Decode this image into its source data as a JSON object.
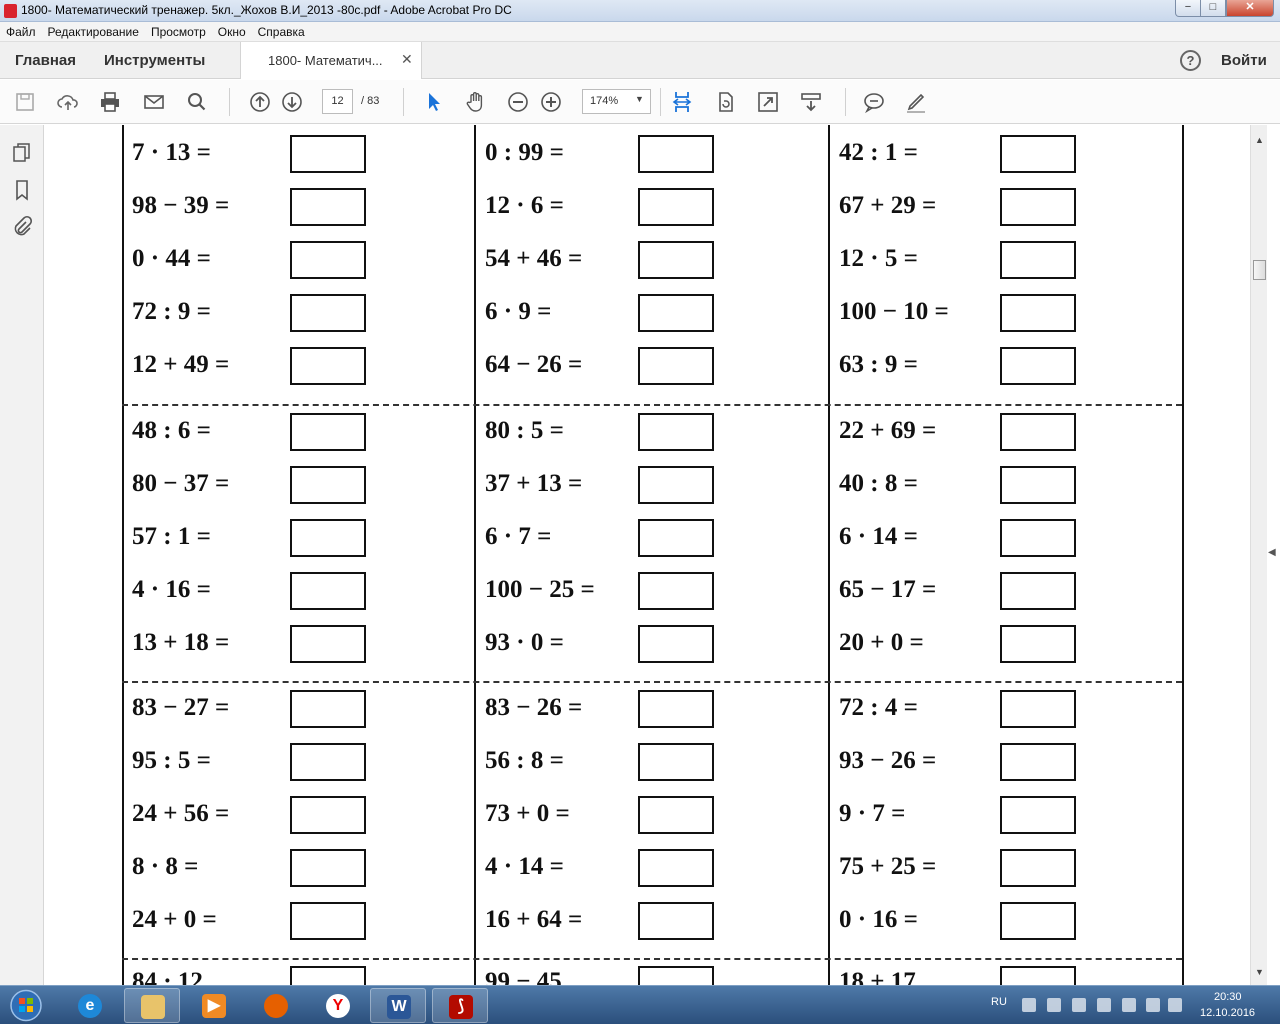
{
  "window": {
    "title": "1800- Математический тренажер. 5кл._Жохов В.И_2013 -80с.pdf - Adobe Acrobat Pro DC",
    "controls": {
      "minimize": "−",
      "maximize": "□",
      "close": "✕"
    }
  },
  "menu": [
    "Файл",
    "Редактирование",
    "Просмотр",
    "Окно",
    "Справка"
  ],
  "nav": {
    "home": "Главная",
    "tools": "Инструменты",
    "doc_tab": "1800- Математич...",
    "doc_tab_close": "✕",
    "help": "?",
    "sign_in": "Войти"
  },
  "toolbar": {
    "page_current": "12",
    "page_total": "/ 83",
    "zoom": "174%",
    "zoom_dropdown": "▼",
    "icons": [
      "save-icon",
      "upload-icon",
      "print-icon",
      "email-icon",
      "search-icon",
      "page-up-icon",
      "page-down-icon",
      "select-cursor-icon",
      "hand-tool-icon",
      "zoom-out-icon",
      "zoom-in-icon",
      "fit-page-icon",
      "rotate-icon",
      "fullscreen-icon",
      "scroll-mode-icon",
      "comment-icon",
      "pen-icon"
    ]
  },
  "left_rail": {
    "icons": [
      "pages-icon",
      "bookmark-icon",
      "attachment-icon"
    ],
    "collapse": "◀"
  },
  "scrollbar": {
    "up": "▲",
    "down": "▼",
    "expand": "◀"
  },
  "worksheet": {
    "blocks": [
      [
        [
          "7 · 13 =",
          "98 − 39 =",
          "0 · 44 =",
          "72 : 9 =",
          "12 + 49 ="
        ],
        [
          "0 : 99 =",
          "12 · 6 =",
          "54 + 46 =",
          "6 · 9 =",
          "64 − 26 ="
        ],
        [
          "42 : 1 =",
          "67 + 29 =",
          "12 · 5 =",
          "100 − 10 =",
          "63 : 9 ="
        ]
      ],
      [
        [
          "48 : 6 =",
          "80 − 37 =",
          "57 : 1 =",
          "4 · 16 =",
          "13 + 18 ="
        ],
        [
          "80 : 5 =",
          "37 + 13 =",
          "6 · 7 =",
          "100 − 25 =",
          "93 · 0 ="
        ],
        [
          "22 + 69 =",
          "40 : 8 =",
          "6 · 14 =",
          "65 − 17 =",
          "20 + 0 ="
        ]
      ],
      [
        [
          "83 − 27 =",
          "95 : 5 =",
          "24 + 56 =",
          "8 · 8 =",
          "24 + 0 ="
        ],
        [
          "83 − 26 =",
          "56 : 8 =",
          "73 + 0 =",
          "4 · 14 =",
          "16 + 64 ="
        ],
        [
          "72 : 4 =",
          "93 − 26 =",
          "9 · 7 =",
          "75 + 25 =",
          "0 · 16 ="
        ]
      ]
    ],
    "partial_row": [
      "84 · 12",
      "99 − 45",
      "18 + 17"
    ]
  },
  "taskbar": {
    "apps": [
      "explorer-icon",
      "internet-explorer-icon",
      "folder-icon",
      "media-player-icon",
      "firefox-icon",
      "yandex-icon",
      "word-icon",
      "acrobat-icon"
    ],
    "yandex_glyph": "Y",
    "word_glyph": "W",
    "language": "RU",
    "time": "20:30",
    "date": "12.10.2016"
  }
}
